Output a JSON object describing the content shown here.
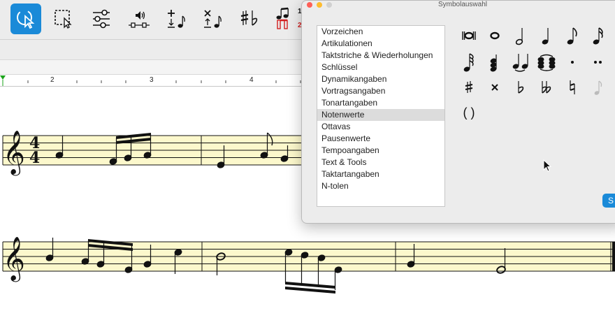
{
  "toolbar": {
    "items": [
      {
        "name": "select-arrow-tool",
        "icon": "pointer-select-icon",
        "active": true
      },
      {
        "name": "marquee-select-tool",
        "icon": "marquee-select-icon"
      },
      {
        "name": "mixer-tool",
        "icon": "sliders-icon"
      },
      {
        "name": "playback-tool",
        "icon": "speaker-playback-icon"
      },
      {
        "name": "insert-note-tool",
        "icon": "insert-note-icon"
      },
      {
        "name": "delete-note-tool",
        "icon": "delete-note-icon"
      },
      {
        "name": "accidentals-tool",
        "icon": "sharp-flat-icon"
      },
      {
        "name": "voices-tool",
        "icon": "voices-icon"
      }
    ],
    "voices_labels": {
      "one": "1",
      "two": "2"
    },
    "accent_color": "#1a8ad8"
  },
  "ruler": {
    "numbers": [
      "2",
      "3",
      "4"
    ]
  },
  "panel": {
    "title": "Symbolauswahl",
    "categories": [
      "Vorzeichen",
      "Artikulationen",
      "Taktstriche & Wiederholungen",
      "Schlüssel",
      "Dynamikangaben",
      "Vortragsangaben",
      "Tonartangaben",
      "Notenwerte",
      "Ottavas",
      "Pausenwerte",
      "Tempoangaben",
      "Text & Tools",
      "Taktartangaben",
      "N-tolen"
    ],
    "selected_category": "Notenwerte",
    "symbols": [
      "breve-icon",
      "whole-note-icon",
      "half-note-icon",
      "quarter-note-icon",
      "eighth-note-icon",
      "sixteenth-note-icon",
      "thirty-second-note-icon",
      "chord-icon",
      "tie-icon",
      "tied-chord-icon",
      "dot-icon",
      "double-dot-icon",
      "sharp-icon",
      "double-sharp-icon",
      "flat-icon",
      "double-flat-icon",
      "natural-icon",
      "grace-note-icon",
      "parentheses-icon"
    ],
    "parentheses_text": "( )",
    "ok_label": "S",
    "traffic_lights": [
      "#fe5f57",
      "#febc2e",
      "#d0d0d0"
    ]
  },
  "score": {
    "staff_color": "#fcf8cc",
    "clef_glyph": "𝄞",
    "time_signature": {
      "top": "4",
      "bottom": "4"
    }
  }
}
